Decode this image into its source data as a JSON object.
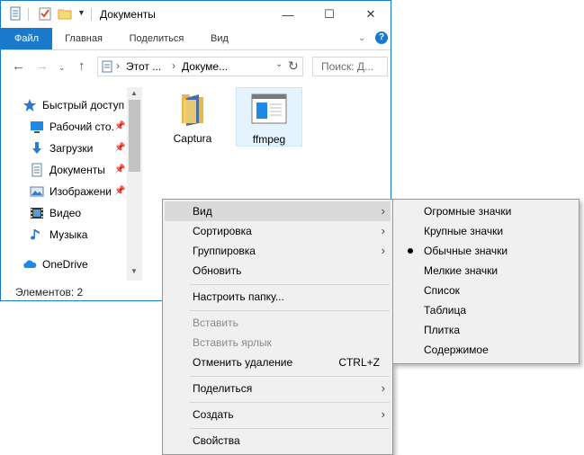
{
  "window": {
    "title": "Документы",
    "controls": {
      "minimize": "—",
      "maximize": "☐",
      "close": "✕"
    }
  },
  "ribbon": {
    "tabs": [
      "Файл",
      "Главная",
      "Поделиться",
      "Вид"
    ],
    "help": "?"
  },
  "address": {
    "segments": [
      "Этот ...",
      "Докуме..."
    ],
    "search_placeholder": "Поиск: Д..."
  },
  "nav": {
    "items": [
      {
        "label": "Быстрый доступ",
        "icon": "star-icon",
        "pinned": false
      },
      {
        "label": "Рабочий сто.",
        "icon": "desktop-icon",
        "pinned": true
      },
      {
        "label": "Загрузки",
        "icon": "download-icon",
        "pinned": true
      },
      {
        "label": "Документы",
        "icon": "documents-icon",
        "pinned": true
      },
      {
        "label": "Изображени",
        "icon": "pictures-icon",
        "pinned": true
      },
      {
        "label": "Видео",
        "icon": "video-icon",
        "pinned": false
      },
      {
        "label": "Музыка",
        "icon": "music-icon",
        "pinned": false
      },
      {
        "label": "OneDrive",
        "icon": "onedrive-icon",
        "pinned": false
      }
    ]
  },
  "files": [
    {
      "name": "Captura",
      "type": "folder"
    },
    {
      "name": "ffmpeg",
      "type": "application"
    }
  ],
  "status": "Элементов: 2",
  "context_menu": {
    "items": [
      {
        "label": "Вид",
        "submenu": true,
        "highlighted": true
      },
      {
        "label": "Сортировка",
        "submenu": true
      },
      {
        "label": "Группировка",
        "submenu": true
      },
      {
        "label": "Обновить"
      },
      {
        "label": "Настроить папку..."
      },
      {
        "label": "Вставить",
        "disabled": true
      },
      {
        "label": "Вставить ярлык",
        "disabled": true
      },
      {
        "label": "Отменить удаление",
        "shortcut": "CTRL+Z"
      },
      {
        "label": "Поделиться",
        "submenu": true
      },
      {
        "label": "Создать",
        "submenu": true
      },
      {
        "label": "Свойства"
      }
    ]
  },
  "view_submenu": {
    "items": [
      {
        "label": "Огромные значки"
      },
      {
        "label": "Крупные значки"
      },
      {
        "label": "Обычные значки",
        "selected": true
      },
      {
        "label": "Мелкие значки"
      },
      {
        "label": "Список"
      },
      {
        "label": "Таблица"
      },
      {
        "label": "Плитка"
      },
      {
        "label": "Содержимое"
      }
    ]
  },
  "colors": {
    "accent": "#1979ca",
    "menu_bg": "#f0f0f0",
    "selection": "#e5f3ff"
  }
}
